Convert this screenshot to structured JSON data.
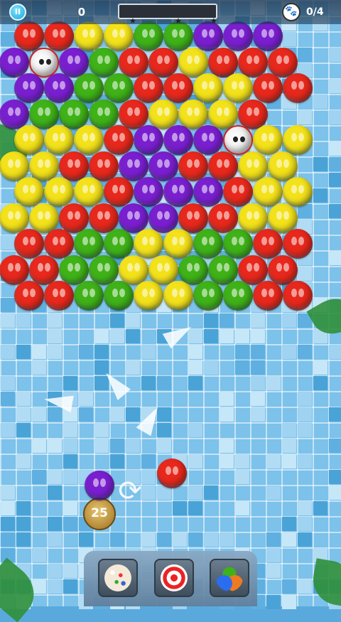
{
  "hud": {
    "pause_icon": "pause-icon",
    "score": "0",
    "progress_fraction": 0.0,
    "pets_label": "0/4",
    "pet_icon": "raccoon-face-icon"
  },
  "colors": {
    "red": "#e8281c",
    "yellow": "#f3e21a",
    "green": "#3fb218",
    "purple": "#7a1fd0"
  },
  "board": {
    "rows": [
      "RRYYGGPPP",
      "PxPGRRYRRR",
      "PPGGRRYYRR",
      "PGGGRYYYR",
      "YYYRPPPxYY",
      "YYRRPPRRYY",
      "YYYRPPPRYY",
      "YYRRPPRRYY",
      "RRGGYYGGRR",
      "RRGGYYGGRR",
      "RRGGYYGGRR"
    ],
    "legend": {
      "R": "red",
      "Y": "yellow",
      "G": "green",
      "P": "purple",
      "x": "pet"
    }
  },
  "shooter": {
    "current_color": "purple",
    "shots_left": "25",
    "next_color": "red",
    "swap_icon": "swap-arrows-icon"
  },
  "boosters": [
    {
      "name": "rainbow-ball-booster",
      "icon": "confetti-ball-icon"
    },
    {
      "name": "aim-target-booster",
      "icon": "target-icon"
    },
    {
      "name": "color-bubbles-booster",
      "icon": "tri-bubble-icon"
    }
  ]
}
